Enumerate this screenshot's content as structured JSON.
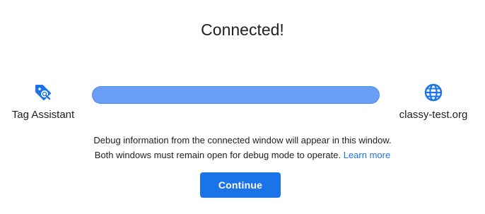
{
  "title": "Connected!",
  "left_endpoint": {
    "label": "Tag Assistant",
    "icon": "tag-assistant-icon"
  },
  "right_endpoint": {
    "label": "classy-test.org",
    "icon": "globe-icon"
  },
  "connection": {
    "progress": 1.0
  },
  "info": {
    "line1": "Debug information from the connected window will appear in this window.",
    "line2": "Both windows must remain open for debug mode to operate.",
    "learn_more": "Learn more"
  },
  "actions": {
    "continue_label": "Continue"
  },
  "colors": {
    "accent": "#1a73e8",
    "progress_fill": "#6a9ef5",
    "text": "#202124"
  }
}
